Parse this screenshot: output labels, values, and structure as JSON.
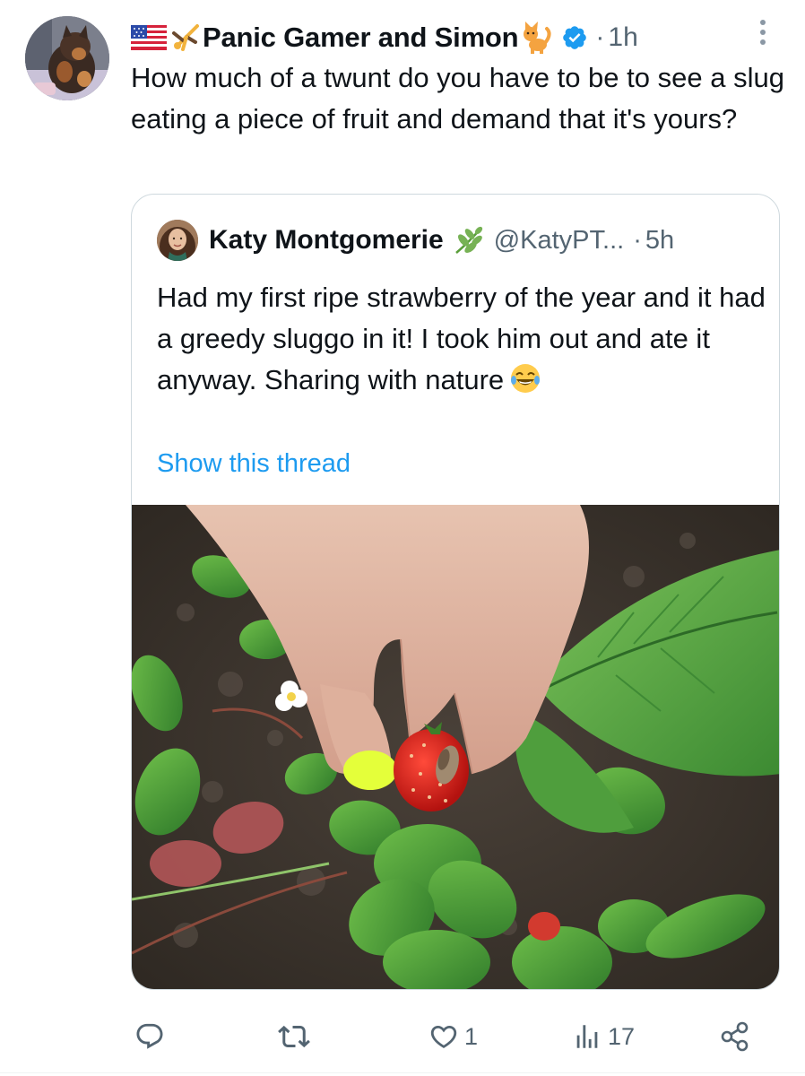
{
  "post": {
    "display_name": "Panic Gamer and Simon",
    "separator": "·",
    "time": "1h",
    "text": "How much of a twunt do you have to be to see a slug eating a piece of fruit and demand that it's yours?"
  },
  "quote": {
    "display_name": "Katy Montgomerie",
    "handle": "@KatyPT...",
    "separator": "·",
    "time": "5h",
    "text": "Had my first ripe strawberry of the year and it had a greedy sluggo in it! I took him out and ate it anyway. Sharing with nature",
    "show_thread": "Show this thread"
  },
  "actions": {
    "reply_count": "",
    "repost_count": "",
    "like_count": "1",
    "views_count": "17"
  },
  "colors": {
    "accent": "#1d9bf0",
    "muted": "#536471",
    "border": "#cfd9de",
    "text": "#0f1419"
  },
  "icons": [
    "us-flag-icon",
    "gymnast-emoji-icon",
    "cat-emoji-icon",
    "verified-badge-icon",
    "more-options-icon",
    "herb-emoji-icon",
    "laughing-emoji-icon",
    "reply-icon",
    "repost-icon",
    "like-icon",
    "views-icon",
    "share-icon"
  ]
}
